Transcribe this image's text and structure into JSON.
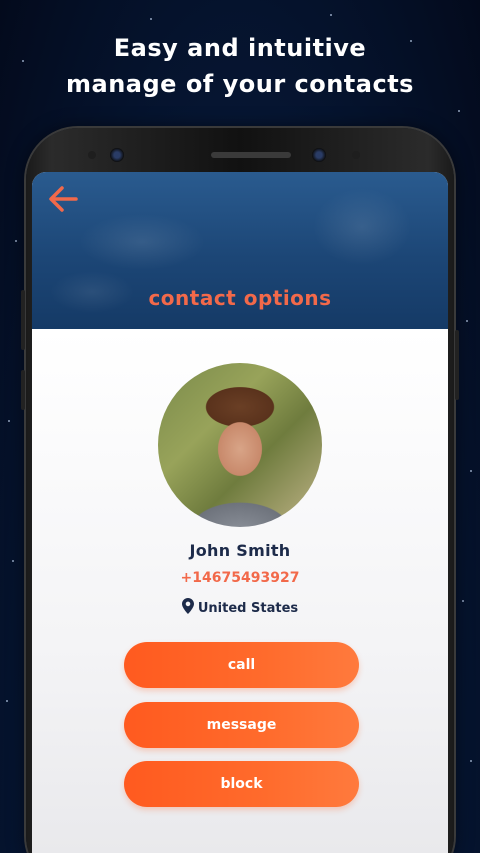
{
  "promo": {
    "line1": "Easy and intuitive",
    "line2": "manage of your contacts"
  },
  "header": {
    "back_icon": "arrow-left-icon",
    "title": "contact options"
  },
  "contact": {
    "name": "John Smith",
    "phone": "+14675493927",
    "location_icon": "map-pin-icon",
    "country": "United States"
  },
  "actions": {
    "call": "call",
    "message": "message",
    "block": "block"
  },
  "colors": {
    "accent": "#f2694a",
    "button": "#ff5a1f",
    "text_dark": "#1d2b4a",
    "header_bg": "#1c4676"
  }
}
